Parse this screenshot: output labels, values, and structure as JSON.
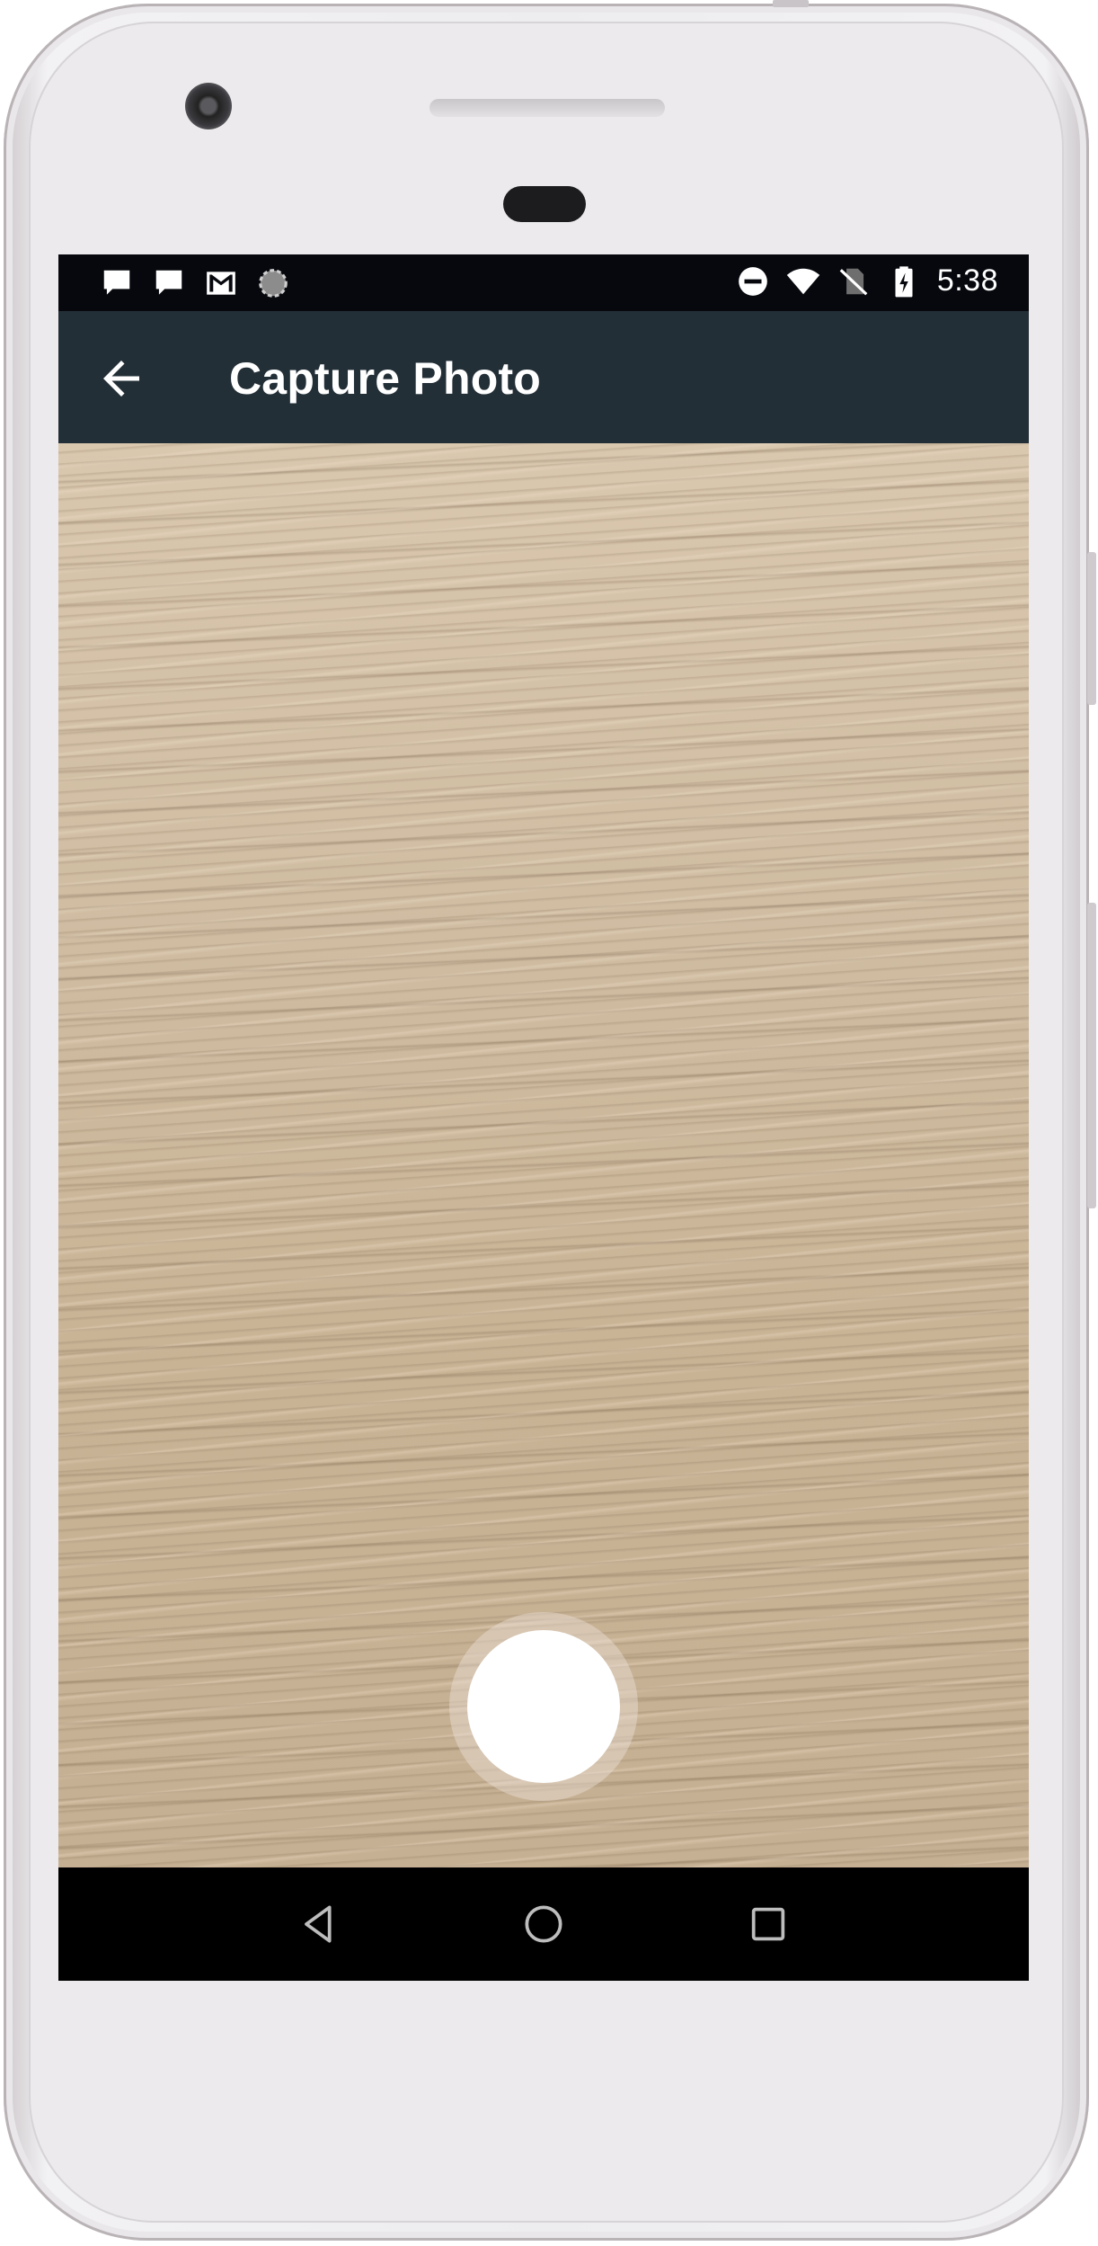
{
  "status_bar": {
    "left_icons": [
      "chat-icon",
      "chat-icon",
      "gmail-icon",
      "sync-icon"
    ],
    "right_icons": [
      "do-not-disturb-icon",
      "wifi-icon",
      "no-sim-icon",
      "battery-charging-icon"
    ],
    "time": "5:38"
  },
  "app_bar": {
    "title": "Capture Photo",
    "back_icon": "arrow-back-icon",
    "color": "#232f37"
  },
  "camera": {
    "shutter_icon": "shutter-button"
  },
  "nav_bar": {
    "buttons": [
      "back-triangle-icon",
      "home-circle-icon",
      "recents-square-icon"
    ]
  }
}
